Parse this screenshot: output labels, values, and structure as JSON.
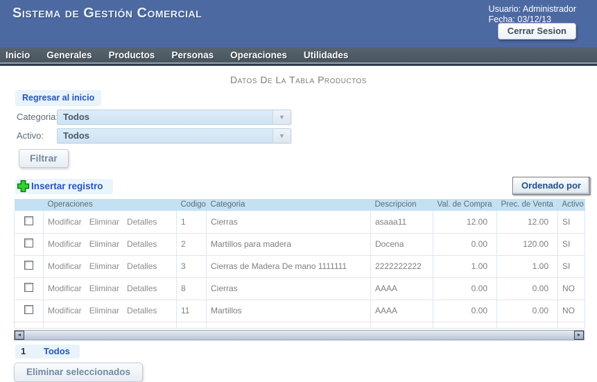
{
  "banner": {
    "title": "Sistema de Gestión Comercial",
    "user_label": "Usuario: Administrador",
    "date_label": "Fecha: 03/12/13",
    "logout_button": "Cerrar Sesion"
  },
  "nav": {
    "items": [
      "Inicio",
      "Generales",
      "Productos",
      "Personas",
      "Operaciones",
      "Utilidades"
    ]
  },
  "main": {
    "page_title": "Datos De La Tabla Productos",
    "back_link": "Regresar al inicio",
    "filters": {
      "categoria_label": "Categoria:",
      "categoria_value": "Todos",
      "activo_label": "Activo:",
      "activo_value": "Todos",
      "filter_button": "Filtrar",
      "order_button": "Ordenado por"
    },
    "insert_link": "Insertar registro",
    "table": {
      "headers": {
        "operaciones": "Operaciones",
        "codigo": "Codigo",
        "categoria": "Categoria",
        "descripcion": "Descripcion",
        "val_compra": "Val. de Compra",
        "prec_venta": "Prec. de Venta",
        "activo": "Activo"
      },
      "row_actions": {
        "modificar": "Modificar",
        "eliminar": "Eliminar",
        "detalles": "Detalles"
      },
      "rows": [
        {
          "codigo": "1",
          "categoria": "Cierras",
          "descripcion": "asaaa11",
          "val_compra": "12.00",
          "prec_venta": "12.00",
          "activo": "SI"
        },
        {
          "codigo": "2",
          "categoria": "Martillos para madera",
          "descripcion": "Docena",
          "val_compra": "0.00",
          "prec_venta": "120.00",
          "activo": "SI"
        },
        {
          "codigo": "3",
          "categoria": "Cierras de Madera De mano 1111111",
          "descripcion": "2222222222",
          "val_compra": "1.00",
          "prec_venta": "1.00",
          "activo": "SI"
        },
        {
          "codigo": "8",
          "categoria": "Cierras",
          "descripcion": "AAAA",
          "val_compra": "0.00",
          "prec_venta": "0.00",
          "activo": "NO"
        },
        {
          "codigo": "11",
          "categoria": "Martillos",
          "descripcion": "AAAA",
          "val_compra": "0.00",
          "prec_venta": "0.00",
          "activo": "NO"
        }
      ]
    },
    "pagination": {
      "current_page": "1",
      "all_label": "Todos"
    },
    "delete_button": "Eliminar seleccionados"
  },
  "icons": {
    "dropdown_arrow": "▼",
    "scroll_left": "◄",
    "scroll_right": "►"
  },
  "colors": {
    "banner_bg": "#4d69a2",
    "nav_bg": "#4d5a66",
    "table_header_bg": "#c3e1f2",
    "link_blue": "#2556b8",
    "plus_green": "#2fd42f"
  }
}
